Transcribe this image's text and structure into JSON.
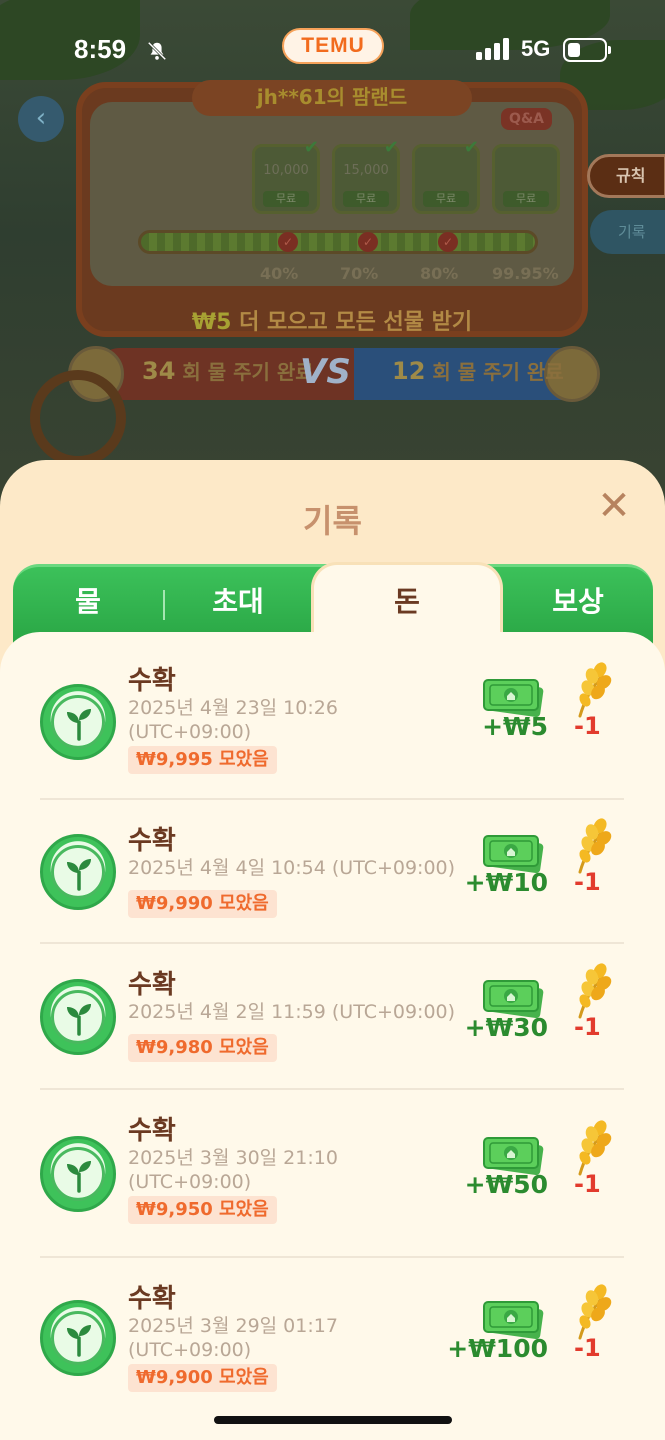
{
  "status_bar": {
    "time": "8:59",
    "app_badge": "TEMU",
    "network": "5G"
  },
  "background": {
    "farm_title": "jh**61의 팜랜드",
    "qa_label": "Q&A",
    "gifts": [
      {
        "amount": "10,000",
        "tag": "무료"
      },
      {
        "amount": "15,000",
        "tag": "무료"
      },
      {
        "amount": "",
        "tag": "무료"
      },
      {
        "amount": "",
        "tag": "무료"
      }
    ],
    "progress_labels": [
      "40%",
      "70%",
      "80%",
      "99.95%"
    ],
    "progress_value": 0.9995,
    "collect_prefix": "₩5",
    "collect_text": "더 모으고 모든 선물 받기",
    "rule_button": "규칙",
    "log_button": "기록",
    "vs_left_count": "34",
    "vs_left_text": "회 물 주기 완료",
    "vs_mid": "VS",
    "vs_right_count": "12",
    "vs_right_text": "회 물 주기 완료"
  },
  "sheet": {
    "title": "기록",
    "close_icon": "close-icon",
    "tabs": [
      {
        "label": "물",
        "active": false
      },
      {
        "label": "초대",
        "active": false
      },
      {
        "label": "돈",
        "active": true
      },
      {
        "label": "보상",
        "active": false
      }
    ],
    "records": [
      {
        "title": "수확",
        "time": "2025년 4월 23일 10:26 (UTC+09:00)",
        "collected": "₩9,995 모았음",
        "money": "+₩5",
        "wheat": "-1"
      },
      {
        "title": "수확",
        "time": "2025년 4월 4일 10:54 (UTC+09:00)",
        "collected": "₩9,990 모았음",
        "money": "+₩10",
        "wheat": "-1"
      },
      {
        "title": "수확",
        "time": "2025년 4월 2일 11:59 (UTC+09:00)",
        "collected": "₩9,980 모았음",
        "money": "+₩30",
        "wheat": "-1"
      },
      {
        "title": "수확",
        "time": "2025년 3월 30일 21:10 (UTC+09:00)",
        "collected": "₩9,950 모았음",
        "money": "+₩50",
        "wheat": "-1"
      },
      {
        "title": "수확",
        "time": "2025년 3월 29일 01:17 (UTC+09:00)",
        "collected": "₩9,900 모았음",
        "money": "+₩100",
        "wheat": "-1"
      }
    ]
  },
  "colors": {
    "accent_green": "#2fa84a",
    "brown_text": "#6b3a22",
    "money_green": "#2b8b2f",
    "minus_red": "#e23b2d",
    "badge_orange": "#ef6a2d"
  }
}
